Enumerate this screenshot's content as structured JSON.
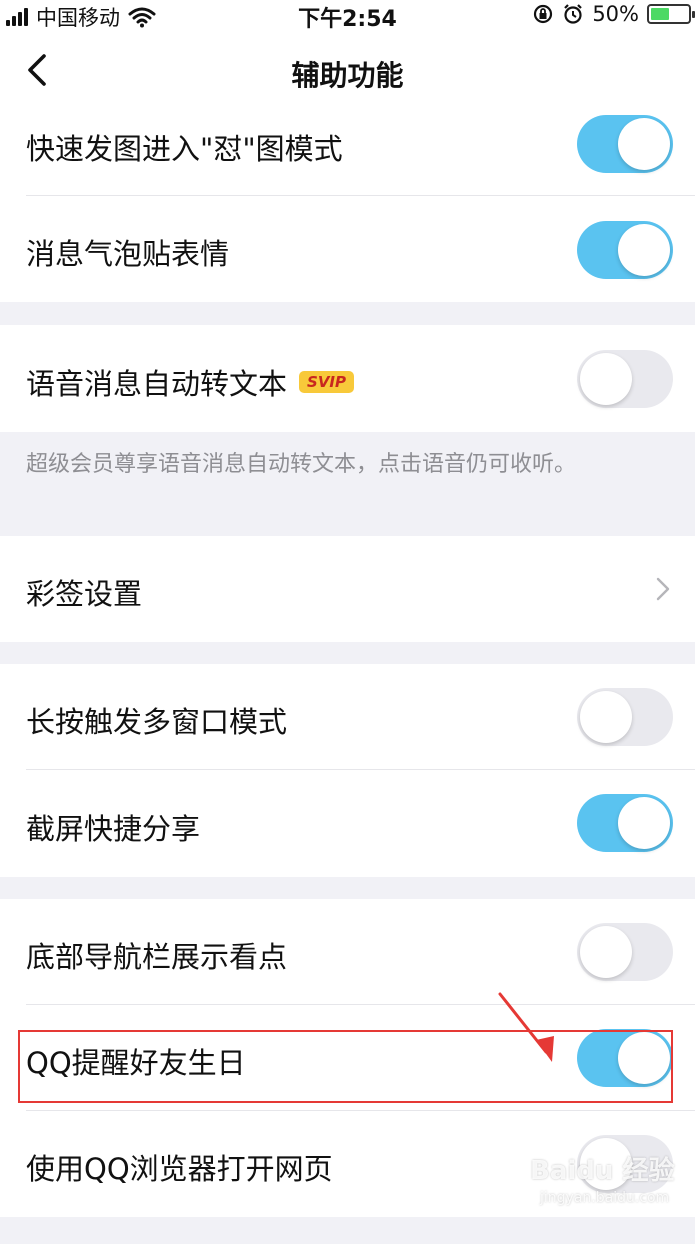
{
  "status_bar": {
    "carrier": "中国移动",
    "time": "下午2:54",
    "battery_percent": "50%",
    "battery_level": 0.5,
    "icons": [
      "signal-icon",
      "wifi-icon",
      "rotation-lock-icon",
      "alarm-icon",
      "battery-icon"
    ]
  },
  "nav": {
    "title": "辅助功能",
    "back_icon": "chevron-left-icon"
  },
  "settings": [
    {
      "label": "快速发图进入\"怼\"图模式",
      "enabled": true
    },
    {
      "label": "消息气泡贴表情",
      "enabled": true
    },
    {
      "label": "语音消息自动转文本",
      "badge": "SVIP",
      "enabled": false
    },
    {
      "label": "彩签设置",
      "type": "link"
    },
    {
      "label": "长按触发多窗口模式",
      "enabled": false
    },
    {
      "label": "截屏快捷分享",
      "enabled": true
    },
    {
      "label": "底部导航栏展示看点",
      "enabled": false
    },
    {
      "label": "QQ提醒好友生日",
      "enabled": true
    },
    {
      "label": "使用QQ浏览器打开网页",
      "enabled": false
    }
  ],
  "note_text": "超级会员尊享语音消息自动转文本，点击语音仍可收听。",
  "colors": {
    "toggle_on": "#5ac3f0",
    "toggle_off": "#e9e9ee",
    "highlight": "#e53935",
    "svip_bg": "#f8c93a",
    "svip_text": "#c8271f"
  },
  "watermark": {
    "brand": "Baidu 经验",
    "url": "jingyan.baidu.com"
  }
}
